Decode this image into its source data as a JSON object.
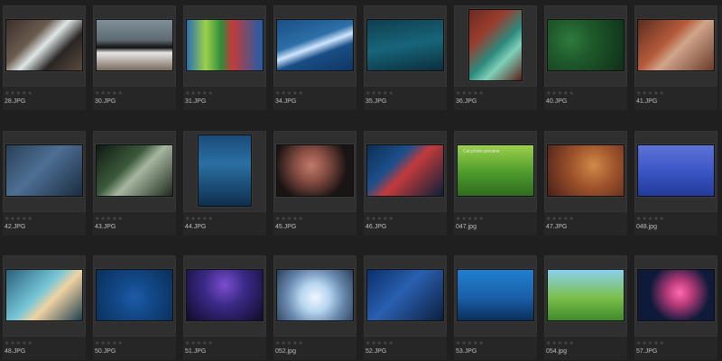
{
  "app": {
    "theme": "dark",
    "accent": "#2f2f2f"
  },
  "rating": {
    "stars": "★★★★★"
  },
  "rows": [
    [
      {
        "name": "28.JPG",
        "orient": "land",
        "bg": "linear-gradient(135deg,#3a2f2b 0%,#6b5b4e 35%,#dfe7e7 50%,#2a2624 70%,#5a4a3d 100%)",
        "icon": "fish-thumbnail-icon"
      },
      {
        "name": "30.JPG",
        "orient": "land",
        "bg": "linear-gradient(180deg,#7f8f98 0%,#5e6a73 40%,#111 55%,#e6e6e6 65%,#7a6a5e 100%)",
        "icon": "puffin-thumbnail-icon"
      },
      {
        "name": "31.JPG",
        "orient": "land",
        "bg": "linear-gradient(90deg,#2a6fb2 0%,#9cd04a 25%,#2f8d3a 45%,#c23b3b 60%,#1f5ea8 100%)",
        "icon": "parrots-thumbnail-icon"
      },
      {
        "name": "34.JPG",
        "orient": "land",
        "bg": "linear-gradient(160deg,#1a4e86 0%,#2c6fa8 40%,#cfe6ff 52%,#194e86 65%,#0f3561 100%)",
        "icon": "shark-thumbnail-icon"
      },
      {
        "name": "35.JPG",
        "orient": "land",
        "bg": "linear-gradient(170deg,#0e3e4f 0%,#17657a 50%,#0b2f3d 100%)",
        "icon": "underwater-thumbnail-icon"
      },
      {
        "name": "36.JPG",
        "orient": "port",
        "bg": "linear-gradient(135deg,#6a2a22 0%,#9a3c2d 30%,#2d8a7e 55%,#7fd1b8 70%,#5a1f1a 100%)",
        "icon": "fish-thumbnail-icon"
      },
      {
        "name": "40.JPG",
        "orient": "land",
        "bg": "radial-gradient(circle at 30% 40%,#2f7a3d 0%,#1f5a2b 35%,#0f2f18 100%)",
        "icon": "coral-thumbnail-icon"
      },
      {
        "name": "41.JPG",
        "orient": "land",
        "bg": "linear-gradient(135deg,#5a2d1f 0%,#b65b3b 40%,#d0a58a 55%,#6a3b2a 100%)",
        "icon": "pufferfish-thumbnail-icon"
      }
    ],
    [
      {
        "name": "42.JPG",
        "orient": "land",
        "bg": "linear-gradient(135deg,#2a3f58 0%,#4d6f93 45%,#1b2c40 100%)",
        "icon": "fish-thumbnail-icon"
      },
      {
        "name": "43.JPG",
        "orient": "land",
        "bg": "linear-gradient(135deg,#0f1a12 0%,#3c5a3b 40%,#a7b6a1 55%,#1f2b1c 100%)",
        "icon": "shark-thumbnail-icon"
      },
      {
        "name": "44.JPG",
        "orient": "port",
        "bg": "linear-gradient(180deg,#1a4b7a 0%,#2b6fa3 40%,#0e2f4d 100%)",
        "icon": "sea-lion-thumbnail-icon"
      },
      {
        "name": "45.JPG",
        "orient": "land",
        "bg": "radial-gradient(circle at 45% 40%,#c07a6a 0%,#8a4f44 30%,#1a1414 70%)",
        "icon": "octopus-thumbnail-icon"
      },
      {
        "name": "46.JPG",
        "orient": "land",
        "bg": "linear-gradient(135deg,#0c2f57 0%,#1c4f8a 35%,#c33b3b 52%,#0a1f3a 100%)",
        "icon": "fish-thumbnail-icon"
      },
      {
        "name": "047.jpg",
        "orient": "land",
        "bg": "linear-gradient(180deg,#9bd04a 0%,#4c9a2b 55%,#2f6b1f 100%)",
        "icon": "cat-thumbnail-icon",
        "caption": "Cat photo preview"
      },
      {
        "name": "47.JPG",
        "orient": "land",
        "bg": "radial-gradient(circle at 60% 40%,#d08a4a 0%,#a0542b 40%,#4a1f1a 100%)",
        "icon": "kitten-thumbnail-icon"
      },
      {
        "name": "048.jpg",
        "orient": "land",
        "bg": "linear-gradient(180deg,#5d73d6 0%,#3c57c6 50%,#223b9a 100%)",
        "icon": "cat-fishbowl-thumbnail-icon"
      }
    ],
    [
      {
        "name": "48.JPG",
        "orient": "land",
        "bg": "linear-gradient(135deg,#2a5f7a 0%,#76c7d7 45%,#f0d3a3 60%,#1f3f4f 100%)",
        "icon": "stingray-thumbnail-icon"
      },
      {
        "name": "50.JPG",
        "orient": "land",
        "bg": "radial-gradient(circle at 50% 55%,#1e5aa8 0%,#124a8a 35%,#0a2f5a 100%)",
        "icon": "fish-school-thumbnail-icon"
      },
      {
        "name": "51.JPG",
        "orient": "land",
        "bg": "radial-gradient(circle at 50% 30%,#7c4dcf 0%,#3a2a86 40%,#110a2a 100%)",
        "icon": "jellyfish-thumbnail-icon"
      },
      {
        "name": "052.jpg",
        "orient": "land",
        "bg": "radial-gradient(circle at 50% 55%,#f0f6ff 0%,#b7d6f0 30%,#6a8ab0 60%,#2a3f5a 100%)",
        "icon": "cat-bubble-thumbnail-icon"
      },
      {
        "name": "52.JPG",
        "orient": "land",
        "bg": "linear-gradient(135deg,#0a2f6b 0%,#2a5fb0 45%,#0b1f3f 100%)",
        "icon": "whale-thumbnail-icon"
      },
      {
        "name": "53.JPG",
        "orient": "land",
        "bg": "linear-gradient(180deg,#1f7fd0 0%,#1a5fa8 55%,#0a2f5a 100%)",
        "icon": "sharks-thumbnail-icon"
      },
      {
        "name": "054.jpg",
        "orient": "land",
        "bg": "linear-gradient(180deg,#8ad0f0 0%,#7bbf4a 55%,#3f8a2b 100%)",
        "icon": "kitten-thumbnail-icon"
      },
      {
        "name": "57.JPG",
        "orient": "land",
        "bg": "radial-gradient(circle at 55% 45%,#ff6bb0 0%,#b83a7a 25%,#0f1a3a 60%)",
        "icon": "fish-thumbnail-icon"
      }
    ]
  ]
}
